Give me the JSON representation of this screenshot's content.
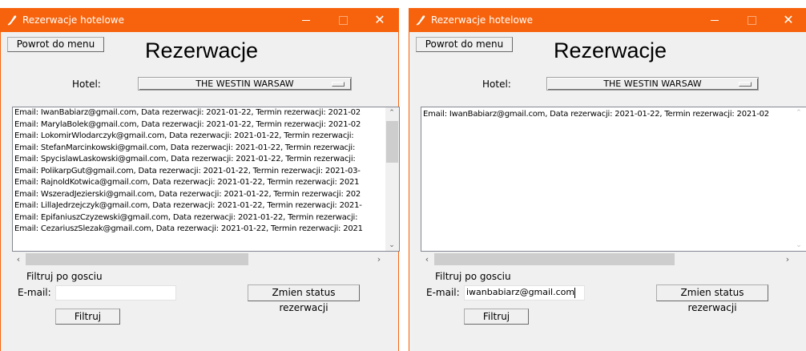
{
  "windows": [
    {
      "title": "Rezerwacje hotelowe",
      "back_button": "Powrot do menu",
      "heading": "Rezerwacje",
      "hotel_label": "Hotel:",
      "hotel_selected": "THE WESTIN WARSAW",
      "reservations": [
        "Email: IwanBabiarz@gmail.com, Data rezerwacji: 2021-01-22, Termin rezerwacji: 2021-02",
        "Email: MarylaBolek@gmail.com, Data rezerwacji: 2021-01-22, Termin rezerwacji: 2021-02",
        "Email: LokomirWlodarczyk@gmail.com, Data rezerwacji: 2021-01-22, Termin rezerwacji:",
        "Email: StefanMarcinkowski@gmail.com, Data rezerwacji: 2021-01-22, Termin rezerwacji:",
        "Email: SpycislawLaskowski@gmail.com, Data rezerwacji: 2021-01-22, Termin rezerwacji:",
        "Email: PolikarpGut@gmail.com, Data rezerwacji: 2021-01-22, Termin rezerwacji: 2021-03-",
        "Email: RajnoldKotwica@gmail.com, Data rezerwacji: 2021-01-22, Termin rezerwacji: 2021",
        "Email: WszeradJezierski@gmail.com, Data rezerwacji: 2021-01-22, Termin rezerwacji: 202",
        "Email: LillaJedrzejczyk@gmail.com, Data rezerwacji: 2021-01-22, Termin rezerwacji: 2021-",
        "Email: EpifaniuszCzyzewski@gmail.com, Data rezerwacji: 2021-01-22, Termin rezerwacji:",
        "Email: CezariuszSlezak@gmail.com, Data rezerwacji: 2021-01-22, Termin rezerwacji: 2021"
      ],
      "filter_label": "Filtruj po gosciu",
      "email_label": "E-mail:",
      "email_value": "",
      "status_button": "Zmien status rezerwacji",
      "filter_button": "Filtruj"
    },
    {
      "title": "Rezerwacje hotelowe",
      "back_button": "Powrot do menu",
      "heading": "Rezerwacje",
      "hotel_label": "Hotel:",
      "hotel_selected": "THE WESTIN WARSAW",
      "reservations": [
        "Email: IwanBabiarz@gmail.com, Data rezerwacji: 2021-01-22, Termin rezerwacji: 2021-02"
      ],
      "filter_label": "Filtruj po gosciu",
      "email_label": "E-mail:",
      "email_value": "iwanbabiarz@gmail.com",
      "status_button": "Zmien status rezerwacji",
      "filter_button": "Filtruj"
    }
  ],
  "icons": {
    "app": "feather-icon",
    "minimize": "minimize-icon",
    "maximize": "maximize-icon",
    "close": "close-icon",
    "scroll_up": "chevron-up-icon",
    "scroll_down": "chevron-down-icon",
    "scroll_left": "chevron-left-icon",
    "scroll_right": "chevron-right-icon"
  },
  "colors": {
    "titlebar": "#f7630c",
    "window_bg": "#f0f0f0"
  }
}
